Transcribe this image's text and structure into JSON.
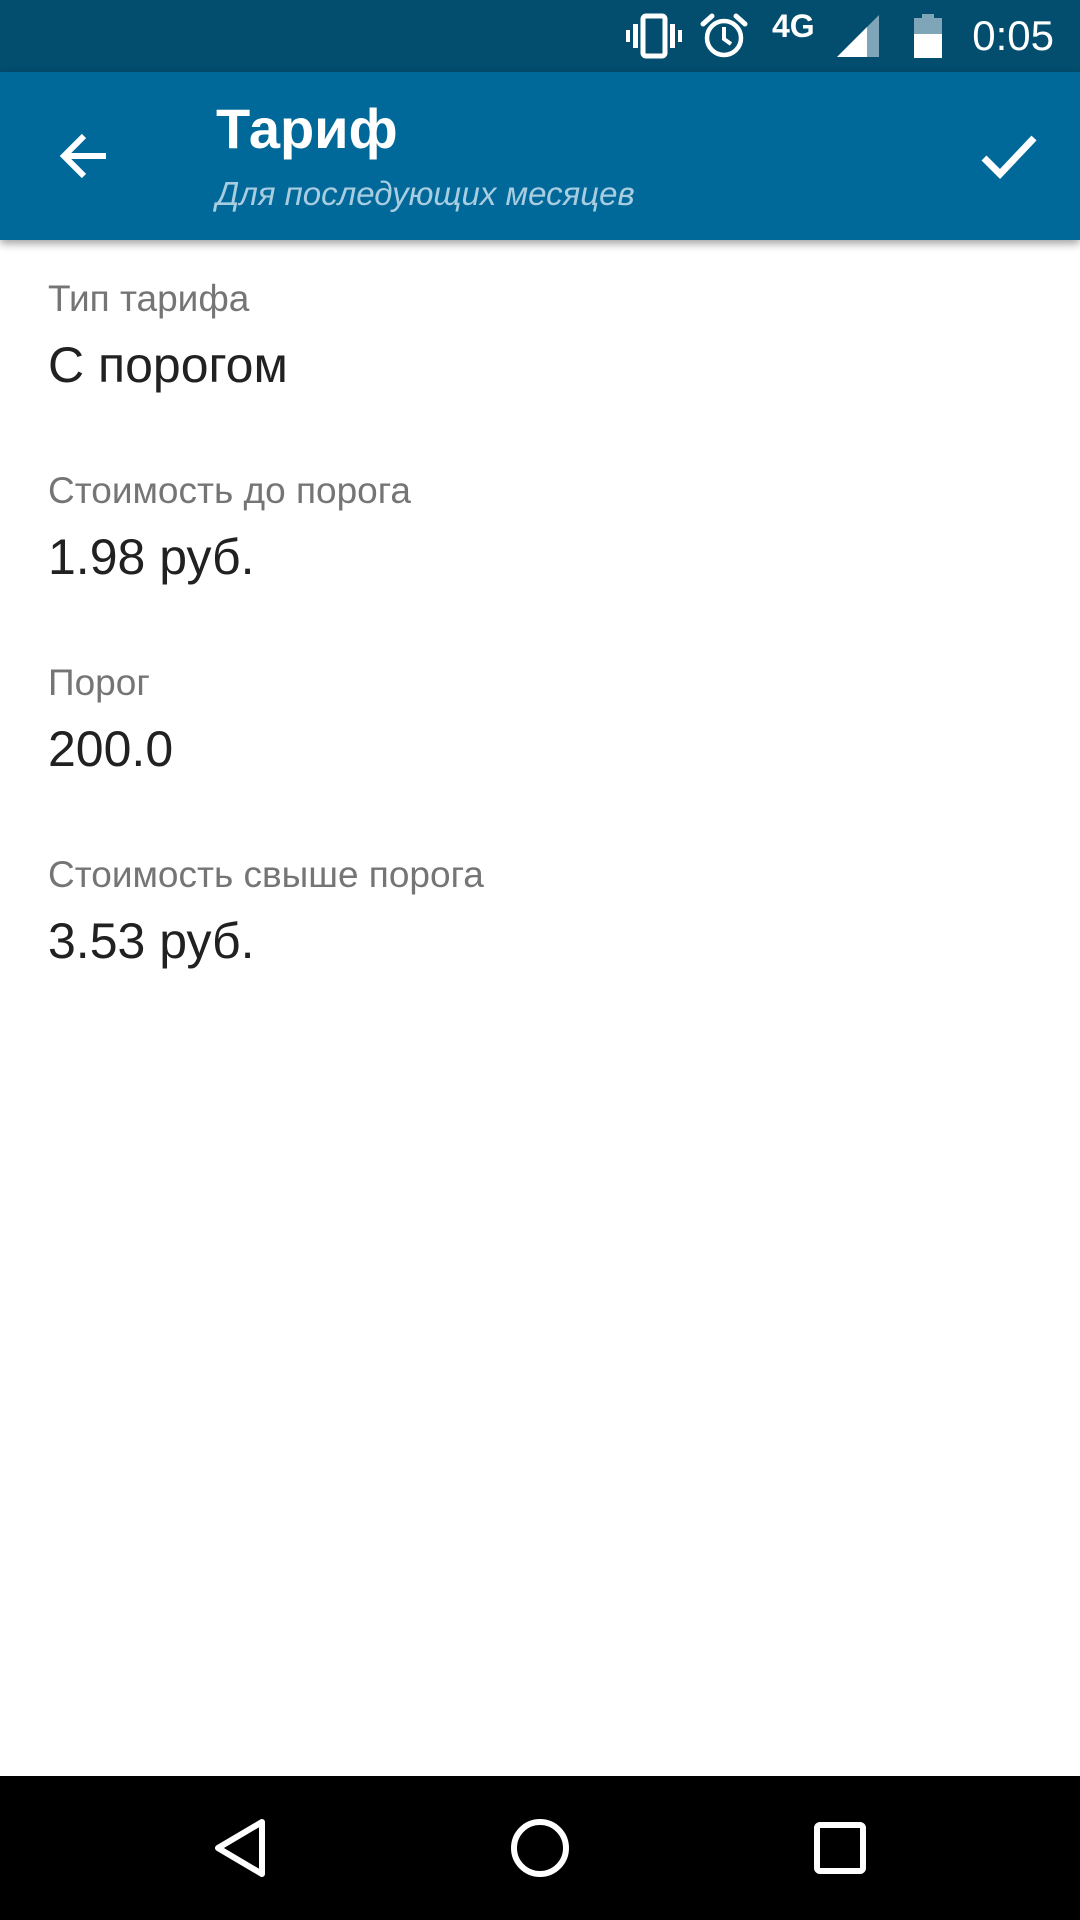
{
  "status_bar": {
    "network": "4G",
    "time": "0:05",
    "icons": [
      "vibrate-icon",
      "alarm-icon",
      "signal-icon",
      "battery-icon"
    ]
  },
  "app_bar": {
    "title": "Тариф",
    "subtitle": "Для последующих месяцев",
    "back_icon": "arrow-back-icon",
    "confirm_icon": "check-icon",
    "background_color": "#00699a",
    "status_color": "#034d6e"
  },
  "settings": [
    {
      "label": "Тип тарифа",
      "value": "С порогом"
    },
    {
      "label": "Стоимость до порога",
      "value": "1.98 руб."
    },
    {
      "label": "Порог",
      "value": "200.0"
    },
    {
      "label": "Стоимость свыше порога",
      "value": "3.53 руб."
    }
  ],
  "nav_bar": {
    "icons": [
      "nav-back-icon",
      "nav-home-icon",
      "nav-recents-icon"
    ]
  }
}
